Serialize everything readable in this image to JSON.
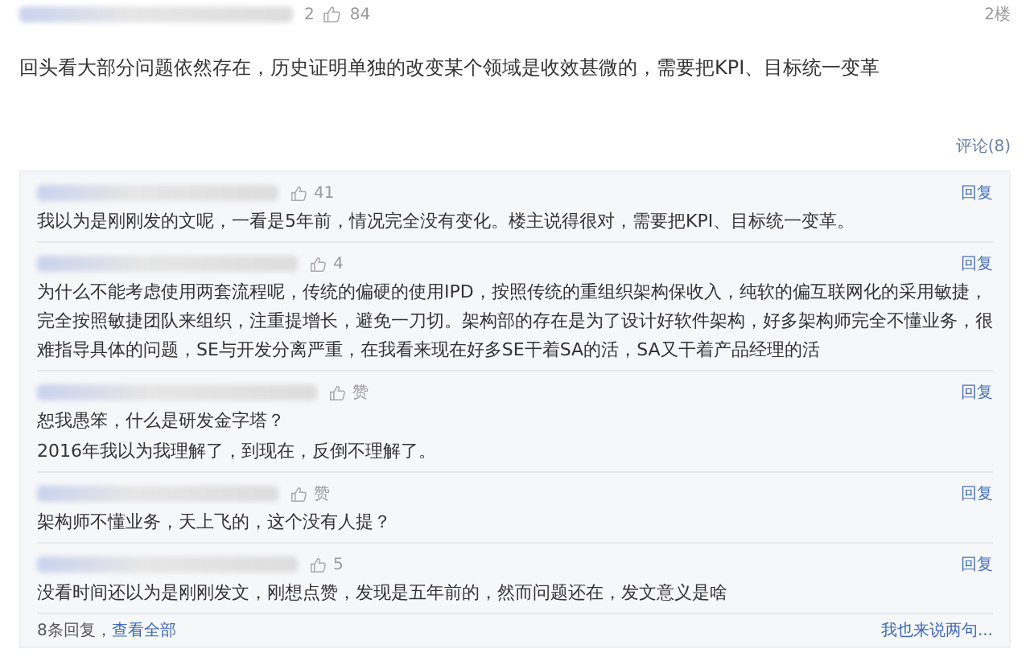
{
  "post": {
    "reply_count": "2",
    "likes": "84",
    "floor": "2楼",
    "text": "回头看大部分问题依然存在，历史证明单独的改变某个领域是收效甚微的，需要把KPI、目标统一变革",
    "comments_link": "评论(8)"
  },
  "replies": [
    {
      "likes": "41",
      "reply": "回复",
      "lines": [
        "我以为是刚刚发的文呢，一看是5年前，情况完全没有变化。楼主说得很对，需要把KPI、目标统一变革。"
      ]
    },
    {
      "likes": "4",
      "reply": "回复",
      "lines": [
        "为什么不能考虑使用两套流程呢，传统的偏硬的使用IPD，按照传统的重组织架构保收入，纯软的偏互联网化的采用敏捷，完全按照敏捷团队来组织，注重提增长，避免一刀切。架构部的存在是为了设计好软件架构，好多架构师完全不懂业务，很难指导具体的问题，SE与开发分离严重，在我看来现在好多SE干着SA的活，SA又干着产品经理的活"
      ]
    },
    {
      "likes": "赞",
      "reply": "回复",
      "lines": [
        "恕我愚笨，什么是研发金字塔？",
        "2016年我以为我理解了，到现在，反倒不理解了。"
      ]
    },
    {
      "likes": "赞",
      "reply": "回复",
      "lines": [
        "架构师不懂业务，天上飞的，这个没有人提？"
      ]
    },
    {
      "likes": "5",
      "reply": "回复",
      "lines": [
        "没看时间还以为是刚刚发文，刚想点赞，发现是五年前的，然而问题还在，发文意义是啥"
      ]
    }
  ],
  "footer": {
    "count": "8条回复，",
    "view_all": "查看全部",
    "write": "我也来说两句..."
  }
}
